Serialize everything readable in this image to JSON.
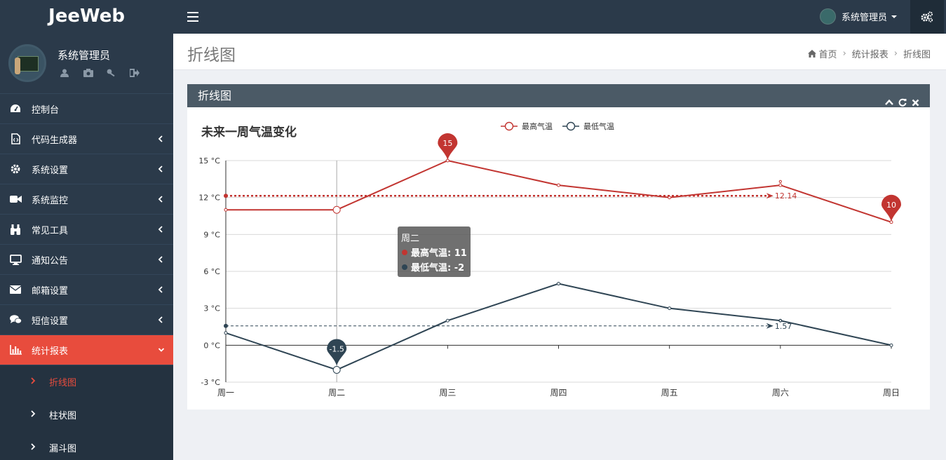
{
  "brand": "JeeWeb",
  "user": {
    "name": "系统管理员"
  },
  "sidebar": {
    "items": [
      {
        "label": "控制台",
        "icon": "dashboard-icon",
        "expandable": false
      },
      {
        "label": "代码生成器",
        "icon": "code-file-icon",
        "expandable": true
      },
      {
        "label": "系统设置",
        "icon": "gear-icon",
        "expandable": true
      },
      {
        "label": "系统监控",
        "icon": "video-camera-icon",
        "expandable": true
      },
      {
        "label": "常见工具",
        "icon": "binoculars-icon",
        "expandable": true
      },
      {
        "label": "通知公告",
        "icon": "monitor-icon",
        "expandable": true
      },
      {
        "label": "邮箱设置",
        "icon": "envelope-icon",
        "expandable": true
      },
      {
        "label": "短信设置",
        "icon": "comments-icon",
        "expandable": true
      },
      {
        "label": "统计报表",
        "icon": "bar-chart-icon",
        "expandable": true,
        "active": true
      }
    ],
    "sub_items": [
      {
        "label": "折线图",
        "active": true
      },
      {
        "label": "柱状图"
      },
      {
        "label": "漏斗图"
      }
    ]
  },
  "topbar": {
    "user_name": "系统管理员"
  },
  "page": {
    "title": "折线图",
    "breadcrumb": [
      "首页",
      "统计报表",
      "折线图"
    ]
  },
  "panel": {
    "title": "折线图"
  },
  "colors": {
    "accent": "#e84c3d",
    "max_series": "#c23531",
    "min_series": "#2f4554",
    "sidebar": "#2b3a4a"
  },
  "chart_data": {
    "type": "line",
    "title": "未来一周气温变化",
    "categories": [
      "周一",
      "周二",
      "周三",
      "周四",
      "周五",
      "周六",
      "周日"
    ],
    "y_unit": "°C",
    "ylim": [
      -3,
      15
    ],
    "y_ticks": [
      -3,
      0,
      3,
      6,
      9,
      12,
      15
    ],
    "legend_position": "top-center",
    "series": [
      {
        "name": "最高气温",
        "values": [
          11,
          11,
          15,
          13,
          12,
          13,
          10
        ],
        "mark_point_max": "15",
        "mark_point_min": "10",
        "average": 12.14,
        "average_label": "12.14"
      },
      {
        "name": "最低气温",
        "values": [
          1,
          -2,
          2,
          5,
          3,
          2,
          0
        ],
        "mark_point_min": "-1.5",
        "average": 1.57,
        "average_label": "1.57"
      }
    ],
    "tooltip": {
      "title": "周二",
      "lines": [
        "最高气温: 11",
        "最低气温: -2"
      ]
    }
  }
}
